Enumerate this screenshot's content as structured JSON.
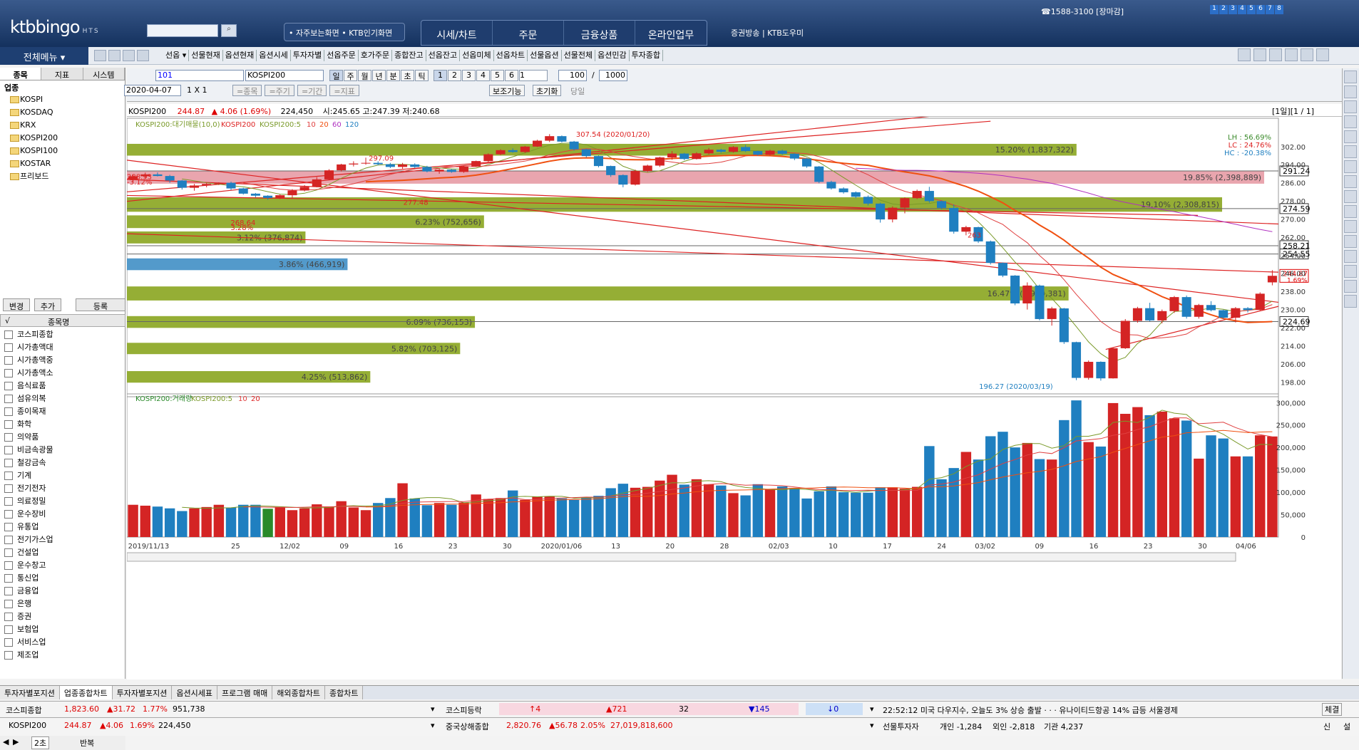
{
  "app": {
    "logo_main": "ktbbingo",
    "logo_sub": "HTS",
    "search_placeholder": "",
    "quick_links": "• 자주보는화면 • KTB인기화면",
    "main_tabs": [
      "시세/차트",
      "주문",
      "금융상품",
      "온라인업무"
    ],
    "broadcast": "증권방송 | KTB도우미",
    "phone": "☎1588-3100 [장마감]",
    "screen_nums": [
      "1",
      "2",
      "3",
      "4",
      "5",
      "6",
      "7",
      "8"
    ]
  },
  "toolbar": {
    "all_menu": "전체메뉴 ▾",
    "menu_items": [
      "선옵 ▾",
      "선물현재",
      "옵션현재",
      "옵션시세",
      "투자자별",
      "선옵주문",
      "호가주문",
      "종합잔고",
      "선옵잔고",
      "선옵미체",
      "선옵차트",
      "선물옵션",
      "선물전체",
      "옵션민감",
      "투자종합"
    ]
  },
  "left_panel": {
    "tabs": [
      "종목",
      "지표",
      "시스템"
    ],
    "tree_root": "업종",
    "tree_items": [
      "KOSPI",
      "KOSDAQ",
      "KRX",
      "KOSPI200",
      "KOSPI100",
      "KOSTAR",
      "프리보드"
    ],
    "buttons": [
      "변경",
      "추가",
      "등록"
    ],
    "list_header": "종목명",
    "sectors": [
      "코스피종합",
      "시가총액대",
      "시가총액중",
      "시가총액소",
      "음식료품",
      "섬유의복",
      "종이목재",
      "화학",
      "의약품",
      "비금속광물",
      "철강금속",
      "기계",
      "전기전자",
      "의료정밀",
      "운수장비",
      "유통업",
      "전기가스업",
      "건설업",
      "운수창고",
      "통신업",
      "금융업",
      "은행",
      "증권",
      "보험업",
      "서비스업",
      "제조업"
    ],
    "bottom_interval": "2초",
    "bottom_repeat": "반복"
  },
  "chart_toolbar": {
    "code": "101",
    "name": "KOSPI200",
    "periods": [
      "일",
      "주",
      "월",
      "년",
      "분",
      "초",
      "틱"
    ],
    "nums": [
      "1",
      "2",
      "3",
      "4",
      "5",
      "6"
    ],
    "n_value": "1",
    "count": "100",
    "total": "1000",
    "date": "2020-04-07",
    "ratio": "1 X 1",
    "row2": [
      "=종목",
      "=주기",
      "=기간",
      "=지표"
    ],
    "aux": "보조기능",
    "reset": "초기화",
    "same": "당일"
  },
  "info_line": {
    "symbol": "KOSPI200",
    "price": "244.87",
    "change": "▲ 4.06 (1.69%)",
    "volume": "224,450",
    "ohl": "시:245.65 고:247.39 저:240.68",
    "page": "[1일][1 / 1]"
  },
  "chart_data": {
    "type": "candlestick",
    "title": "KOSPI200:대기매물(10,0)",
    "legend_price": [
      "KOSPI200:대기매물(10,0)",
      "KOSPI200",
      "KOSPI200:5",
      "10",
      "20",
      "60",
      "120"
    ],
    "legend_volume": [
      "KOSPI200:거래량",
      "KOSPI200:5",
      "10",
      "20"
    ],
    "price_axis": [
      302.0,
      294.0,
      286.0,
      278.0,
      270.0,
      262.0,
      254.0,
      246.0,
      238.0,
      230.0,
      222.0,
      214.0,
      206.0,
      198.0
    ],
    "volume_axis": [
      "300,000",
      "250,000",
      "200,000",
      "150,000",
      "100,000",
      "50,000",
      "0"
    ],
    "ylim": [
      194,
      312
    ],
    "volume_lim": [
      0,
      310000
    ],
    "x_labels": [
      "2019/11/13",
      "25",
      "12/02",
      "09",
      "16",
      "23",
      "30",
      "2020/01/06",
      "13",
      "20",
      "28",
      "02/03",
      "10",
      "17",
      "24",
      "03/02",
      "09",
      "16",
      "23",
      "30",
      "04/06"
    ],
    "hlines": [
      {
        "value": 291.24,
        "label": "291.24"
      },
      {
        "value": 274.59,
        "label": "274.59"
      },
      {
        "value": 258.21,
        "label": "258.21"
      },
      {
        "value": 254.55,
        "label": "254.55"
      },
      {
        "value": 224.69,
        "label": "224.69"
      }
    ],
    "current_price": {
      "value": 244.87,
      "label": "244.87",
      "pct": "1.69%"
    },
    "annotations": [
      {
        "text": "307.54 (2020/01/20)",
        "value": 307.54
      },
      {
        "text": "196.27 (2020/03/19)",
        "value": 196.27
      },
      {
        "text": "288.93",
        "value": 288.93
      },
      {
        "text": "-3.12%",
        "value": 286.5
      },
      {
        "text": "297.09",
        "value": 297.09
      },
      {
        "text": "268.64",
        "value": 268.64
      },
      {
        "text": "3.28%",
        "value": 266.3
      },
      {
        "text": "277.48",
        "value": 277.48
      },
      {
        "text": "263",
        "value": 263
      }
    ],
    "lh_lc_hc": [
      "LH : 56.69%",
      "LC : 24.76%",
      "HC : -20.38%"
    ],
    "volume_profile": [
      {
        "low": 298,
        "high": 303.2,
        "pct": "15.20% (1,837,322)",
        "color": "#8faa2a",
        "len": 0.835
      },
      {
        "low": 285.6,
        "high": 291.3,
        "pct": "19.85% (2,398,889)",
        "color": "#e8a0aa",
        "len": 1.0
      },
      {
        "low": 273.2,
        "high": 279.6,
        "pct": "19.10% (2,308,815)",
        "color": "#8faa2a",
        "len": 0.963
      },
      {
        "low": 266,
        "high": 271.6,
        "pct": "6.23% (752,656)",
        "color": "#8faa2a",
        "len": 0.314
      },
      {
        "low": 259.2,
        "high": 264.5,
        "pct": "3.12% (376,874)",
        "color": "#8faa2a",
        "len": 0.157
      },
      {
        "low": 247.4,
        "high": 252.6,
        "pct": "3.86% (466,919)",
        "color": "#4a95c8",
        "len": 0.194
      },
      {
        "low": 234,
        "high": 240.2,
        "pct": "16.47% (1,990,381)",
        "color": "#8faa2a",
        "len": 0.828
      },
      {
        "low": 221.9,
        "high": 227.1,
        "pct": "6.09% (736,153)",
        "color": "#8faa2a",
        "len": 0.306
      },
      {
        "low": 210.3,
        "high": 215.3,
        "pct": "5.82% (703,125)",
        "color": "#8faa2a",
        "len": 0.293
      },
      {
        "low": 197.7,
        "high": 202.8,
        "pct": "4.25% (513,862)",
        "color": "#8faa2a",
        "len": 0.214
      }
    ],
    "candles": [
      [
        287.5,
        289.5,
        286.0,
        288.9
      ],
      [
        288.9,
        290.5,
        288.0,
        289.7
      ],
      [
        289.7,
        290.6,
        288.8,
        289.0
      ],
      [
        289.0,
        289.5,
        286.0,
        287.0
      ],
      [
        287.0,
        287.2,
        283.0,
        283.8
      ],
      [
        283.8,
        285.5,
        282.5,
        284.8
      ],
      [
        284.8,
        286.0,
        284.0,
        285.5
      ],
      [
        285.5,
        286.2,
        285.0,
        286.0
      ],
      [
        286.0,
        286.5,
        282.8,
        283.5
      ],
      [
        283.5,
        283.8,
        280.8,
        281.2
      ],
      [
        281.2,
        281.5,
        279.6,
        280.3
      ],
      [
        280.3,
        280.5,
        278.5,
        279.3
      ],
      [
        279.3,
        280.8,
        278.8,
        280.5
      ],
      [
        280.5,
        283.2,
        279.2,
        282.6
      ],
      [
        282.6,
        285.0,
        282.2,
        284.2
      ],
      [
        284.2,
        288.5,
        284.0,
        287.5
      ],
      [
        287.5,
        292.0,
        287.2,
        291.5
      ],
      [
        291.5,
        294.4,
        291.0,
        294.1
      ],
      [
        294.1,
        295.5,
        293.2,
        294.5
      ],
      [
        294.5,
        297.1,
        294.0,
        294.8
      ],
      [
        294.8,
        295.5,
        293.8,
        294.2
      ],
      [
        294.2,
        294.8,
        292.5,
        293.0
      ],
      [
        293.0,
        294.8,
        292.2,
        294.1
      ],
      [
        294.1,
        294.6,
        292.5,
        293.0
      ],
      [
        293.0,
        293.5,
        290.6,
        291.0
      ],
      [
        291.0,
        292.2,
        290.0,
        291.8
      ],
      [
        291.8,
        292.0,
        290.4,
        290.8
      ],
      [
        290.8,
        293.5,
        290.4,
        293.3
      ],
      [
        293.3,
        295.8,
        293.0,
        295.6
      ],
      [
        295.6,
        299.0,
        295.2,
        298.6
      ],
      [
        298.6,
        300.8,
        298.2,
        300.4
      ],
      [
        300.4,
        301.2,
        299.3,
        299.6
      ],
      [
        299.6,
        302.3,
        299.2,
        302.0
      ],
      [
        302.0,
        305.0,
        301.8,
        304.6
      ],
      [
        304.6,
        307.5,
        304.0,
        306.6
      ],
      [
        306.6,
        306.9,
        303.8,
        304.2
      ],
      [
        304.2,
        304.5,
        300.2,
        300.8
      ],
      [
        300.8,
        301.0,
        297.2,
        297.8
      ],
      [
        297.8,
        298.0,
        292.8,
        293.4
      ],
      [
        293.4,
        293.6,
        288.6,
        289.4
      ],
      [
        289.4,
        289.7,
        284.0,
        285.2
      ],
      [
        285.2,
        291.8,
        284.8,
        291.2
      ],
      [
        291.2,
        294.0,
        290.8,
        293.6
      ],
      [
        293.6,
        297.5,
        293.0,
        297.2
      ],
      [
        297.2,
        300.0,
        296.2,
        298.9
      ],
      [
        298.9,
        299.2,
        296.0,
        296.5
      ],
      [
        296.5,
        299.5,
        296.3,
        299.0
      ],
      [
        299.0,
        301.4,
        298.5,
        300.6
      ],
      [
        300.6,
        301.0,
        299.2,
        299.7
      ],
      [
        299.7,
        302.2,
        299.3,
        301.8
      ],
      [
        301.8,
        302.8,
        299.6,
        300.0
      ],
      [
        300.0,
        300.2,
        298.0,
        298.4
      ],
      [
        298.4,
        300.6,
        298.0,
        300.2
      ],
      [
        300.2,
        300.6,
        298.3,
        298.8
      ],
      [
        298.8,
        299.0,
        296.0,
        296.7
      ],
      [
        296.7,
        297.0,
        292.6,
        293.2
      ],
      [
        293.2,
        293.4,
        285.8,
        286.4
      ],
      [
        286.4,
        286.9,
        283.0,
        283.5
      ],
      [
        283.5,
        284.0,
        281.2,
        281.8
      ],
      [
        281.8,
        282.2,
        279.2,
        279.8
      ],
      [
        279.8,
        280.4,
        276.0,
        276.8
      ],
      [
        276.8,
        277.2,
        268.4,
        269.8
      ],
      [
        269.8,
        275.6,
        268.5,
        275.0
      ],
      [
        275.0,
        279.6,
        272.5,
        279.2
      ],
      [
        279.2,
        283.0,
        278.8,
        282.4
      ],
      [
        282.4,
        284.2,
        277.2,
        277.9
      ],
      [
        277.9,
        278.1,
        274.3,
        274.9
      ],
      [
        274.9,
        276.4,
        263.5,
        264.4
      ],
      [
        264.4,
        267.0,
        262.8,
        266.4
      ],
      [
        266.4,
        266.6,
        259.4,
        260.1
      ],
      [
        260.1,
        260.5,
        249.9,
        250.6
      ],
      [
        250.6,
        250.8,
        244.3,
        245.0
      ],
      [
        245.0,
        245.2,
        231.9,
        232.7
      ],
      [
        232.7,
        242.0,
        230.0,
        240.6
      ],
      [
        240.6,
        241.0,
        225.2,
        225.8
      ],
      [
        225.8,
        231.2,
        222.9,
        230.5
      ],
      [
        230.5,
        230.7,
        214.8,
        215.6
      ],
      [
        215.6,
        215.8,
        198.8,
        199.8
      ],
      [
        199.8,
        207.5,
        199.0,
        206.9
      ],
      [
        206.9,
        207.1,
        198.6,
        199.6
      ],
      [
        199.6,
        213.3,
        199.5,
        212.9
      ],
      [
        212.9,
        225.8,
        212.6,
        225.0
      ],
      [
        225.0,
        231.2,
        224.2,
        230.6
      ],
      [
        230.6,
        233.0,
        224.8,
        225.2
      ],
      [
        225.2,
        230.0,
        223.9,
        229.3
      ],
      [
        229.3,
        236.0,
        228.5,
        235.5
      ],
      [
        235.5,
        236.2,
        226.0,
        226.8
      ],
      [
        226.8,
        232.5,
        226.0,
        232.0
      ],
      [
        232.0,
        233.7,
        229.2,
        229.7
      ],
      [
        229.7,
        229.9,
        225.9,
        226.4
      ],
      [
        226.4,
        231.1,
        224.3,
        230.6
      ],
      [
        230.6,
        231.1,
        228.7,
        229.8
      ],
      [
        229.8,
        237.6,
        229.6,
        237.0
      ],
      [
        242.0,
        247.4,
        240.7,
        244.9
      ]
    ],
    "volumes": [
      72000,
      70000,
      68000,
      64000,
      58000,
      64000,
      67000,
      72000,
      66000,
      72000,
      72000,
      63000,
      66000,
      60000,
      64000,
      73000,
      67000,
      80000,
      66000,
      60000,
      76000,
      87000,
      120000,
      86000,
      71000,
      76000,
      72000,
      77000,
      95000,
      85000,
      87000,
      104000,
      83000,
      90000,
      91000,
      86000,
      83000,
      88000,
      92000,
      109000,
      119000,
      110000,
      112000,
      126000,
      139000,
      117000,
      129000,
      118000,
      115000,
      98000,
      93000,
      118000,
      106000,
      113000,
      109000,
      86000,
      102000,
      113000,
      100000,
      99000,
      99000,
      111000,
      111000,
      108000,
      112000,
      203000,
      129000,
      154000,
      190000,
      173000,
      225000,
      235000,
      200000,
      210000,
      174000,
      173000,
      261000,
      305000,
      212000,
      202000,
      299000,
      275000,
      290000,
      272000,
      280000,
      265000,
      260000,
      175000,
      227000,
      220000,
      180000,
      180000,
      227000,
      224450
    ],
    "green_volume_index": 11,
    "trendlines": [
      {
        "from": [
          0.0,
          287.5
        ],
        "to": [
          1.0,
          267.8
        ]
      },
      {
        "from": [
          0.0,
          296.0
        ],
        "to": [
          1.0,
          233.2
        ]
      },
      {
        "from": [
          0.0,
          263.5
        ],
        "to": [
          1.0,
          246.5
        ]
      },
      {
        "from": [
          0.0,
          277.8
        ],
        "to": [
          0.75,
          318.2
        ]
      },
      {
        "from": [
          0.0,
          282.0
        ],
        "to": [
          0.75,
          313.2
        ]
      },
      {
        "from": [
          0.0,
          280.4
        ],
        "to": [
          0.93,
          271.6
        ]
      },
      {
        "from": [
          0.85,
          212.4
        ],
        "to": [
          1.0,
          231.4
        ]
      }
    ]
  },
  "bottom_tabs": [
    "투자자별포지션",
    "업종종합차트",
    "투자자별포지션",
    "옵션시세표",
    "프로그램 매매",
    "해외종합차트",
    "종합차트"
  ],
  "status1": {
    "kospi_label": "코스피종합",
    "kospi_value": "1,823.60",
    "kospi_change": "▲31.72",
    "kospi_pct": "1.77%",
    "kospi_vol": "951,738",
    "adv_label": "코스피등락",
    "up_limit": "↑4",
    "up": "▲721",
    "same": "32",
    "down": "▼145",
    "down_limit": "↓0",
    "news": "22:52:12  미국 다우지수, 오늘도 3% 상승 출발 · · · 유나이티드항공 14% 급등  서울경제",
    "right_btn": "체결"
  },
  "status2": {
    "label": "KOSPI200",
    "value": "244.87",
    "change": "▲4.06",
    "pct": "1.69%",
    "vol": "224,450",
    "china_label": "중국상해종합",
    "china_value": "2,820.76",
    "china_change": "▲56.78",
    "china_pct": "2.05%",
    "china_vol": "27,019,818,600",
    "investor_label": "선물투자자",
    "individual": "개인 -1,284",
    "foreign": "외인 -2,818",
    "institution": "기관 4,237",
    "right_btn1": "신",
    "right_btn2": "설"
  }
}
